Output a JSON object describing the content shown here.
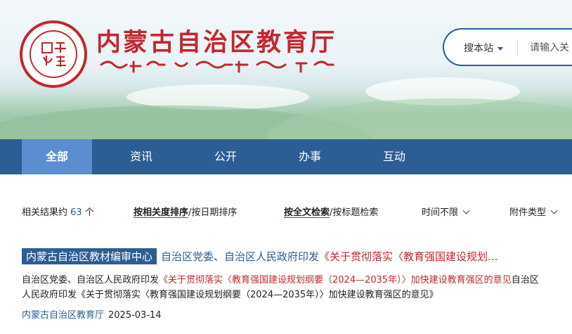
{
  "header": {
    "site_title": "内蒙古自治区教育厅",
    "logo_icon": "emblem-seal-icon",
    "brand_color": "#c4272e"
  },
  "search": {
    "scope_label": "搜本站",
    "placeholder": "请输入关"
  },
  "nav": {
    "items": [
      {
        "label": "全部",
        "active": true
      },
      {
        "label": "资讯",
        "active": false
      },
      {
        "label": "公开",
        "active": false
      },
      {
        "label": "办事",
        "active": false
      },
      {
        "label": "互动",
        "active": false
      }
    ],
    "color": "#2c5d95",
    "active_color": "#5a8ed0"
  },
  "filters": {
    "result_count_prefix": "相关结果约",
    "result_count": "63",
    "result_count_suffix": "个",
    "sort_relevance": "按相关度排序",
    "sort_date": "/按日期排序",
    "search_fulltext": "按全文检索",
    "search_title": "/按标题检索",
    "time_filter": "时间不限",
    "attachment_filter": "附件类型"
  },
  "result": {
    "source_tag": "内蒙古自治区教材编审中心",
    "title_plain": "自治区党委、自治区人民政府印发",
    "title_highlight": "《关于贯彻落实〈教育强国建设规划...",
    "snippet_1": "自治区党委、自治区人民政府印发",
    "snippet_2": "《关于贯彻落实〈教育强国建设规划纲要（2024—2035年）〉加快建设教育强区的意见",
    "snippet_3": "自治区人民政府印发《关于贯彻落实〈教育强国建设规划纲要（2024—2035年）〉加快建设教育强区的意见》",
    "source_name": "内蒙古自治区教育厅",
    "date": "2025-03-14"
  }
}
